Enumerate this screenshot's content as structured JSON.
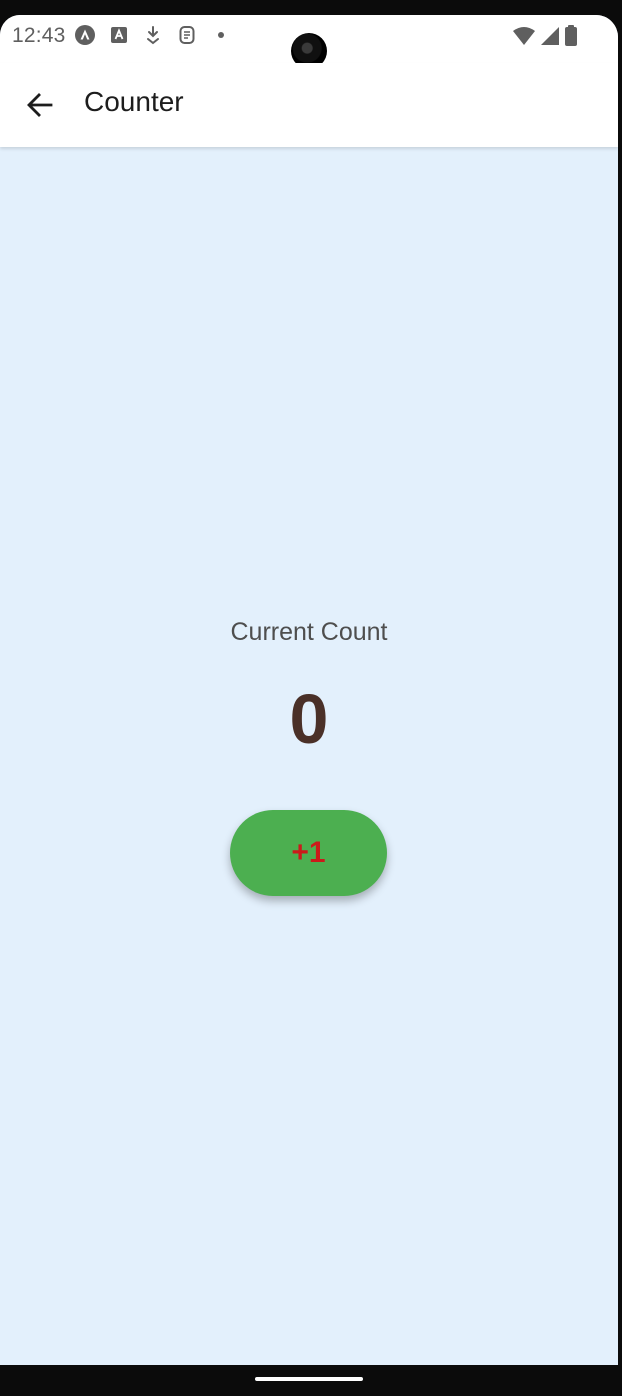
{
  "status_bar": {
    "time": "12:43",
    "icons_left": [
      "android-auto-icon",
      "accessibility-a-icon",
      "download-icon",
      "screenshot-icon",
      "dot-icon"
    ],
    "icons_right": [
      "wifi-icon",
      "signal-icon",
      "battery-icon"
    ]
  },
  "app_bar": {
    "title": "Counter",
    "back_icon": "arrow-back-icon"
  },
  "counter": {
    "label": "Current Count",
    "value": "0",
    "button_label": "+1"
  },
  "colors": {
    "background": "#e3f0fc",
    "button": "#4caf50",
    "button_text": "#cc1a1a",
    "count_value": "#4a3028"
  }
}
